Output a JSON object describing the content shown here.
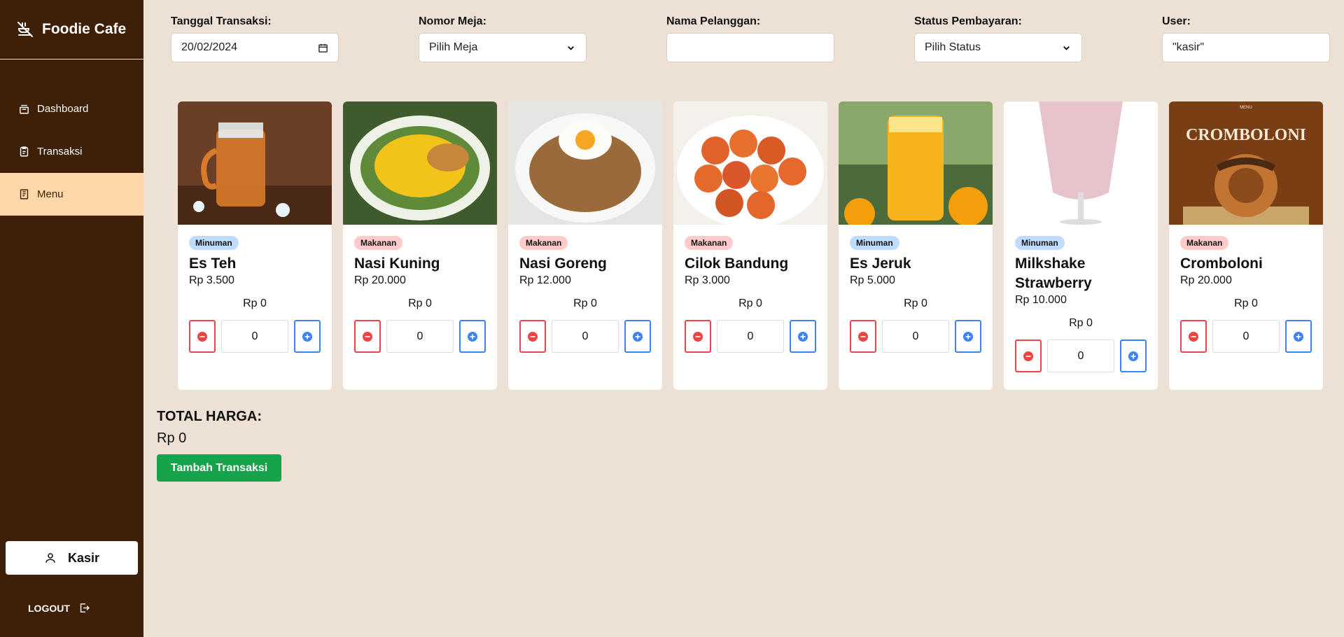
{
  "brand": {
    "name": "Foodie Cafe",
    "icon": "no-food-icon"
  },
  "sidebar": {
    "items": [
      {
        "label": "Dashboard",
        "icon": "box-icon"
      },
      {
        "label": "Transaksi",
        "icon": "clipboard-icon"
      },
      {
        "label": "Menu",
        "icon": "book-icon",
        "active": true
      }
    ],
    "user_label": "Kasir",
    "logout_label": "LOGOUT"
  },
  "form": {
    "tanggal": {
      "label": "Tanggal Transaksi:",
      "value": "20/02/2024"
    },
    "meja": {
      "label": "Nomor Meja:",
      "value": "Pilih Meja"
    },
    "pelanggan": {
      "label": "Nama Pelanggan:",
      "value": ""
    },
    "status": {
      "label": "Status Pembayaran:",
      "value": "Pilih Status"
    },
    "user": {
      "label": "User:",
      "value": "\"kasir\""
    }
  },
  "menu": [
    {
      "category": "Minuman",
      "name": "Es Teh",
      "price": "Rp 3.500",
      "subtotal": "Rp 0",
      "qty": "0"
    },
    {
      "category": "Makanan",
      "name": "Nasi Kuning",
      "price": "Rp 20.000",
      "subtotal": "Rp 0",
      "qty": "0"
    },
    {
      "category": "Makanan",
      "name": "Nasi Goreng",
      "price": "Rp 12.000",
      "subtotal": "Rp 0",
      "qty": "0"
    },
    {
      "category": "Makanan",
      "name": "Cilok Bandung",
      "price": "Rp 3.000",
      "subtotal": "Rp 0",
      "qty": "0"
    },
    {
      "category": "Minuman",
      "name": "Es Jeruk",
      "price": "Rp 5.000",
      "subtotal": "Rp 0",
      "qty": "0"
    },
    {
      "category": "Minuman",
      "name": "Milkshake Strawberry",
      "price": "Rp 10.000",
      "subtotal": "Rp 0",
      "qty": "0"
    },
    {
      "category": "Makanan",
      "name": "Cromboloni",
      "price": "Rp 20.000",
      "subtotal": "Rp 0",
      "qty": "0",
      "image_text": "CROMBOLONI",
      "image_subtext": "MENU"
    }
  ],
  "total": {
    "label": "TOTAL HARGA:",
    "value": "Rp 0"
  },
  "add_button": "Tambah Transaksi",
  "colors": {
    "sidebar": "#3e1f07",
    "active": "#fed7aa",
    "background": "#ede0d4",
    "add": "#16a34a",
    "minus": "#ef4444",
    "plus": "#3b82f6"
  }
}
